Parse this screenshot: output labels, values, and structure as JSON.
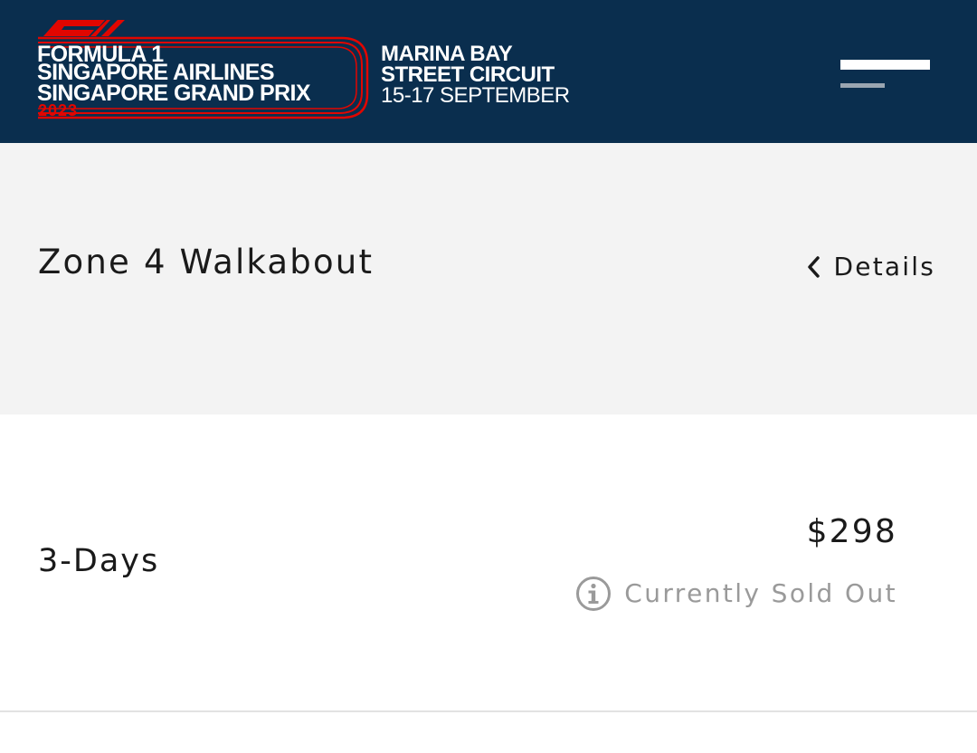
{
  "header": {
    "logo": {
      "line1": "FORMULA 1",
      "line2": "SINGAPORE AIRLINES",
      "line3": "SINGAPORE GRAND PRIX",
      "year": "2023"
    },
    "event": {
      "venue_line1": "MARINA BAY",
      "venue_line2": "STREET CIRCUIT",
      "dates": "15-17 SEPTEMBER"
    },
    "menu_icon": "hamburger-menu-icon"
  },
  "zone": {
    "title": "Zone 4 Walkabout",
    "details_label": "Details",
    "details_icon": "chevron-left-icon"
  },
  "tickets": [
    {
      "name": "3-Days",
      "price": "$298",
      "status": "Currently Sold Out",
      "status_icon": "info-icon"
    }
  ],
  "colors": {
    "header_bg": "#0a2e4e",
    "brand_red": "#e10600",
    "zone_bg": "#f3f3f3",
    "sold_out_text": "#9a9a9a"
  }
}
